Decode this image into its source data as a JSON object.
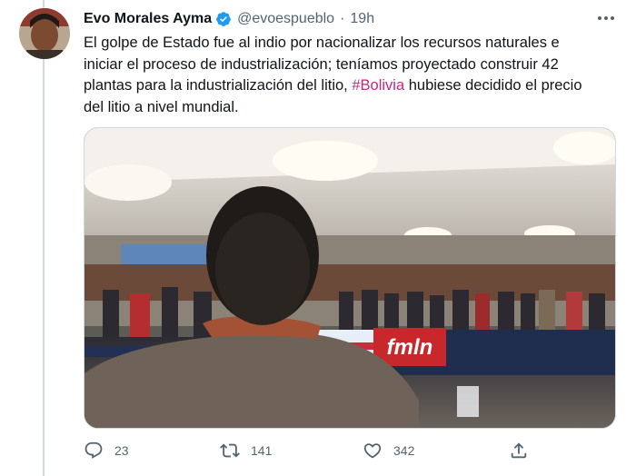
{
  "tweet": {
    "author_name": "Evo Morales Ayma",
    "handle": "@evoespueblo",
    "separator": "·",
    "time": "19h",
    "text_before": "El golpe de Estado fue al indio por nacionalizar los recursos naturales e iniciar el proceso de industrialización; teníamos proyectado construir 42 plantas para la industrialización del litio, ",
    "hashtag": "#Bolivia",
    "text_after": " hubiese decidido el precio del litio a nivel mundial."
  },
  "media": {
    "banner_text": "fmln"
  },
  "actions": {
    "replies": "23",
    "retweets": "141",
    "likes": "342"
  },
  "icons": [
    "verified-icon",
    "more-icon",
    "reply-icon",
    "retweet-icon",
    "like-icon",
    "share-icon"
  ],
  "colors": {
    "verified": "#1d9bf0",
    "hashtag": "#c0297f",
    "secondary_text": "#536471"
  }
}
